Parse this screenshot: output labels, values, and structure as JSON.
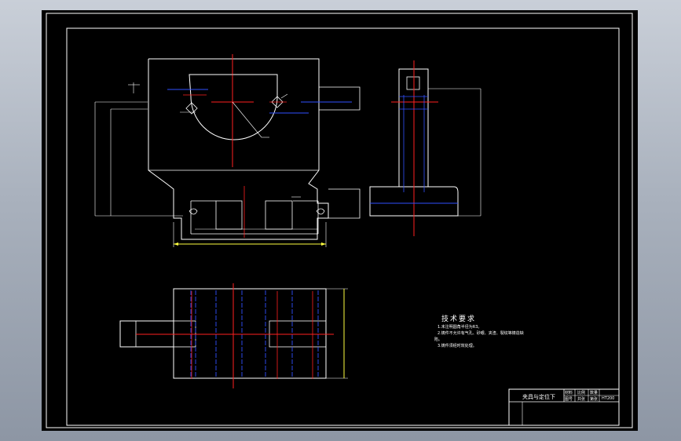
{
  "drawing": {
    "technical_requirements": {
      "title": "技术要求",
      "notes": [
        "1.未注明圆角半径为R3。",
        "2.铸件不允许有气孔、砂眼、夹渣、裂纹等铸造缺",
        "陷。",
        "3.铸件须经时效处理。"
      ]
    },
    "title_block": {
      "part_name": "夹具与定位下",
      "cells": [
        "材料",
        "比例",
        "数量",
        "图号",
        "共张",
        "第张",
        "HT200"
      ]
    }
  },
  "colors": {
    "sheet_background": "#000000",
    "outline": "#ffffff",
    "centerline": "#ff2020",
    "hidden_line": "#3050ff",
    "dimension_line": "#ffff40"
  }
}
